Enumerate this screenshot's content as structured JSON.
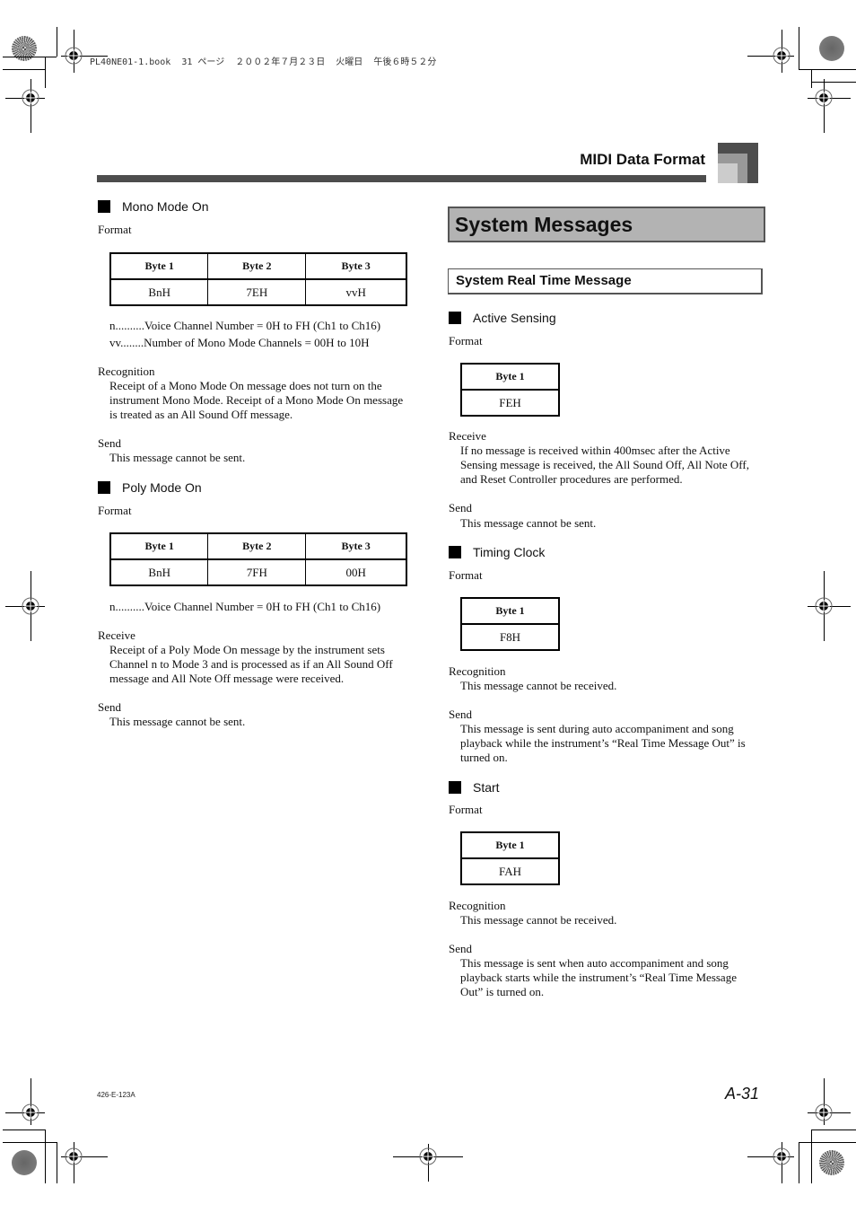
{
  "print_header": "PL40NE01-1.book  31 ページ  ２００２年７月２３日  火曜日  午後６時５２分",
  "running_header": {
    "title": "MIDI Data Format"
  },
  "left_column": {
    "mono_mode": {
      "title": "Mono Mode On",
      "format_label": "Format",
      "table": {
        "headers": [
          "Byte 1",
          "Byte 2",
          "Byte 3"
        ],
        "values": [
          "BnH",
          "7EH",
          "vvH"
        ]
      },
      "notes": [
        "n..........Voice Channel Number = 0H to FH (Ch1 to Ch16)",
        "vv........Number of Mono Mode Channels = 00H to 10H"
      ],
      "recognition_label": "Recognition",
      "recognition_text": "Receipt of a Mono Mode On message does not turn on the instrument Mono Mode. Receipt of a Mono Mode On message is treated as an All Sound Off message.",
      "send_label": "Send",
      "send_text": "This message cannot be sent."
    },
    "poly_mode": {
      "title": "Poly Mode On",
      "format_label": "Format",
      "table": {
        "headers": [
          "Byte 1",
          "Byte 2",
          "Byte 3"
        ],
        "values": [
          "BnH",
          "7FH",
          "00H"
        ]
      },
      "notes": [
        "n..........Voice Channel Number = 0H to FH (Ch1 to Ch16)"
      ],
      "receive_label": "Receive",
      "receive_text": "Receipt of a Poly Mode On message by the instrument sets Channel n to Mode 3 and is processed as if an All Sound Off message and All Note Off message were received.",
      "send_label": "Send",
      "send_text": "This message cannot be sent."
    }
  },
  "right_column": {
    "section_title": "System Messages",
    "subsection_title": "System Real Time Message",
    "active_sensing": {
      "title": "Active Sensing",
      "format_label": "Format",
      "table": {
        "headers": [
          "Byte 1"
        ],
        "values": [
          "FEH"
        ]
      },
      "receive_label": "Receive",
      "receive_text": "If no message is received within 400msec after the Active Sensing message is received, the All Sound Off, All Note Off, and Reset Controller procedures are performed.",
      "send_label": "Send",
      "send_text": "This message cannot be sent."
    },
    "timing_clock": {
      "title": "Timing Clock",
      "format_label": "Format",
      "table": {
        "headers": [
          "Byte 1"
        ],
        "values": [
          "F8H"
        ]
      },
      "recognition_label": "Recognition",
      "recognition_text": "This message cannot be received.",
      "send_label": "Send",
      "send_text": "This message is sent during auto accompaniment and song playback while the instrument’s “Real Time Message Out” is turned on."
    },
    "start": {
      "title": "Start",
      "format_label": "Format",
      "table": {
        "headers": [
          "Byte 1"
        ],
        "values": [
          "FAH"
        ]
      },
      "recognition_label": "Recognition",
      "recognition_text": "This message cannot be received.",
      "send_label": "Send",
      "send_text": "This message is sent when auto accompaniment and song playback starts while the instrument’s “Real Time Message Out” is turned on."
    }
  },
  "footer": {
    "code": "426-E-123A",
    "page_number": "A-31"
  }
}
